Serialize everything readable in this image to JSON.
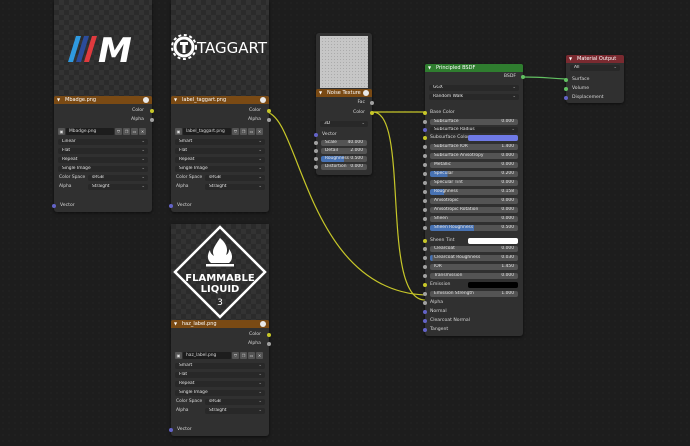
{
  "nodes": {
    "tex1": {
      "title": "Mbadge.png",
      "outputs": [
        "Color",
        "Alpha"
      ],
      "image_name": "Mbadge.png",
      "interpolation": "Linear",
      "projection": "Flat",
      "extension": "Repeat",
      "source": "Single Image",
      "color_space_label": "Color Space",
      "color_space": "sRGB",
      "alpha_label": "Alpha",
      "alpha": "Straight",
      "input": "Vector"
    },
    "tex2": {
      "title": "label_taggart.png",
      "preview_text": "TAGGART",
      "outputs": [
        "Color",
        "Alpha"
      ],
      "image_name": "label_taggart.png",
      "interpolation": "Smart",
      "projection": "Flat",
      "extension": "Repeat",
      "source": "Single Image",
      "color_space_label": "Color Space",
      "color_space": "sRGB",
      "alpha_label": "Alpha",
      "alpha": "Straight",
      "input": "Vector"
    },
    "tex3": {
      "title": "haz_label.png",
      "preview_line1": "FLAMMABLE",
      "preview_line2": "LIQUID",
      "preview_line3": "3",
      "outputs": [
        "Color",
        "Alpha"
      ],
      "image_name": "haz_label.png",
      "interpolation": "Smart",
      "projection": "Flat",
      "extension": "Repeat",
      "source": "Single Image",
      "color_space_label": "Color Space",
      "color_space": "sRGB",
      "alpha_label": "Alpha",
      "alpha": "Straight",
      "input": "Vector"
    },
    "noise": {
      "title": "Noise Texture",
      "outputs": [
        "Fac",
        "Color"
      ],
      "dimensions": "3D",
      "input": "Vector",
      "params": [
        {
          "label": "Scale",
          "value": "40.000",
          "fill": 0
        },
        {
          "label": "Detail",
          "value": "2.000",
          "fill": 0
        },
        {
          "label": "Roughness",
          "value": "0.500",
          "fill": 50
        },
        {
          "label": "Distortion",
          "value": "0.000",
          "fill": 0
        }
      ]
    },
    "bsdf": {
      "title": "Principled BSDF",
      "output": "BSDF",
      "distribution": "GGX",
      "subsurface_method": "Random Walk",
      "base_color_label": "Base Color",
      "subsurface": {
        "label": "Subsurface",
        "value": "0.000"
      },
      "subsurface_radius": "Subsurface Radius",
      "subsurface_color": "Subsurface Color",
      "params": [
        {
          "label": "Subsurface IOR",
          "value": "1.400",
          "fill": 0
        },
        {
          "label": "Subsurface Anisotropy",
          "value": "0.000",
          "fill": 0
        },
        {
          "label": "Metallic",
          "value": "0.000",
          "fill": 0
        },
        {
          "label": "Specular",
          "value": "0.200",
          "fill": 20
        },
        {
          "label": "Specular Tint",
          "value": "0.000",
          "fill": 0
        },
        {
          "label": "Roughness",
          "value": "0.158",
          "fill": 16
        },
        {
          "label": "Anisotropic",
          "value": "0.000",
          "fill": 0
        },
        {
          "label": "Anisotropic Rotation",
          "value": "0.000",
          "fill": 0
        },
        {
          "label": "Sheen",
          "value": "0.000",
          "fill": 0
        },
        {
          "label": "Sheen Roughness",
          "value": "0.500",
          "fill": 50
        }
      ],
      "sheen_tint": "Sheen Tint",
      "params2": [
        {
          "label": "Clearcoat",
          "value": "0.000",
          "fill": 0
        },
        {
          "label": "Clearcoat Roughness",
          "value": "0.030",
          "fill": 3
        },
        {
          "label": "IOR",
          "value": "1.450",
          "fill": 0
        },
        {
          "label": "Transmission",
          "value": "0.000",
          "fill": 0
        }
      ],
      "emission": "Emission",
      "emission_strength": {
        "label": "Emission Strength",
        "value": "1.000"
      },
      "inputs_tail": [
        "Alpha",
        "Normal",
        "Clearcoat Normal",
        "Tangent"
      ]
    },
    "out": {
      "title": "Material Output",
      "target": "All",
      "inputs": [
        "Surface",
        "Volume",
        "Displacement"
      ]
    }
  },
  "colors": {
    "bsdf_header": "#2f7d2f",
    "texture_header": "#7a4a14",
    "output_header": "#7a2a30",
    "link_yellow": "#c7c729",
    "link_green": "#62c062"
  }
}
